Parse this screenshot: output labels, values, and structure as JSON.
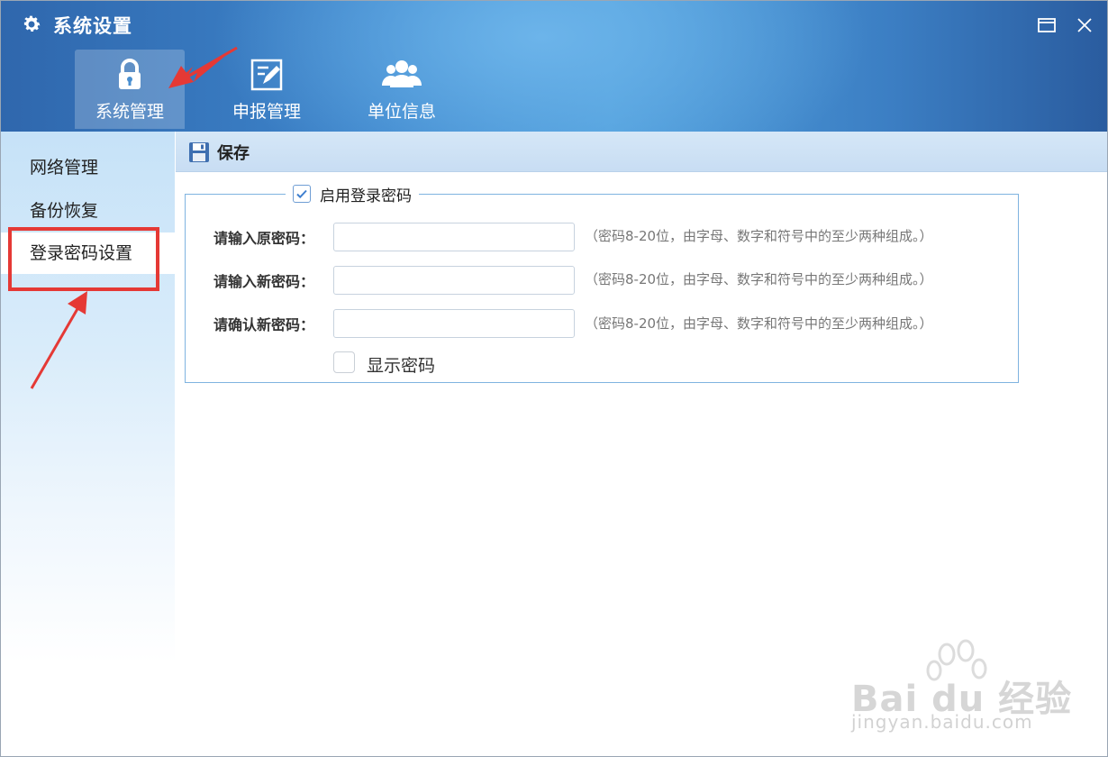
{
  "window": {
    "title": "系统设置"
  },
  "nav": {
    "items": [
      {
        "label": "系统管理",
        "icon": "lock-icon",
        "active": true
      },
      {
        "label": "申报管理",
        "icon": "edit-document-icon",
        "active": false
      },
      {
        "label": "单位信息",
        "icon": "users-icon",
        "active": false
      }
    ]
  },
  "sidebar": {
    "items": [
      {
        "label": "网络管理"
      },
      {
        "label": "备份恢复"
      },
      {
        "label": "登录密码设置",
        "active": true
      }
    ]
  },
  "toolbar": {
    "save_label": "保存"
  },
  "password_group": {
    "enable_label": "启用登录密码",
    "enable_checked": true,
    "fields": [
      {
        "label": "请输入原密码：",
        "value": "",
        "hint": "（密码8-20位，由字母、数字和符号中的至少两种组成。）"
      },
      {
        "label": "请输入新密码：",
        "value": "",
        "hint": "（密码8-20位，由字母、数字和符号中的至少两种组成。）"
      },
      {
        "label": "请确认新密码：",
        "value": "",
        "hint": "（密码8-20位，由字母、数字和符号中的至少两种组成。）"
      }
    ],
    "show_password_label": "显示密码",
    "show_password_checked": false
  },
  "watermark": {
    "brand": "Bai du 经验",
    "url": "jingyan.baidu.com"
  },
  "colors": {
    "annotation": "#e53935",
    "header_dark": "#2f67ad",
    "header_light": "#4f9edb",
    "accent_border": "#7fb3e0"
  }
}
